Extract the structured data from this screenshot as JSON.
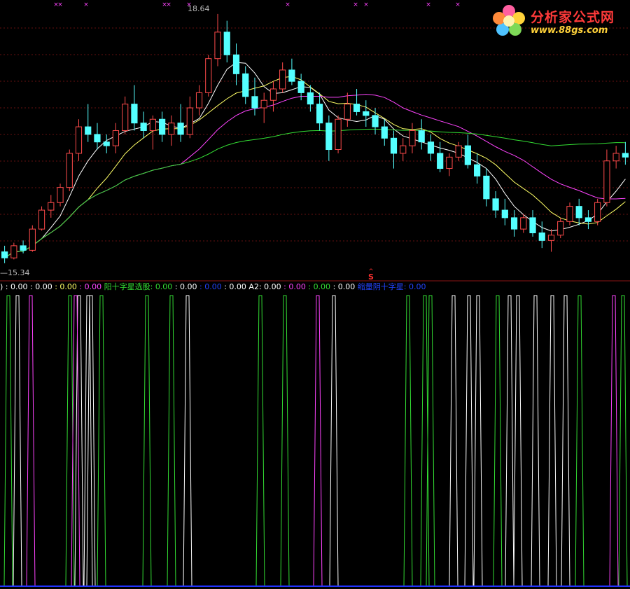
{
  "colors": {
    "background": "#000000",
    "up": "#ff4b4b",
    "down": "#54ffff",
    "ma5": "#ffffff",
    "ma10": "#ffff66",
    "ma20": "#ff44ff",
    "ma60": "#33dd33",
    "grid": "#661010",
    "signal_a": "#33dd33",
    "signal_b": "#ffffff",
    "signal_c": "#ff44ff",
    "bottom_line": "#2233ff"
  },
  "logo": {
    "title": "分析家公式网",
    "url": "www.88gs.com"
  },
  "chart_data": [
    {
      "type": "candlestick",
      "title": "",
      "price_high_label": "18.64",
      "price_low_label": "15.34",
      "high_marker": "18.64",
      "low_marker": "15.34",
      "signal_marker": "S",
      "ylim": [
        15.2,
        18.75
      ],
      "grid": true,
      "moving_averages": [
        "MA5",
        "MA10",
        "MA20",
        "MA60"
      ],
      "ohlc": [
        [
          15.5,
          15.58,
          15.35,
          15.42
        ],
        [
          15.42,
          15.62,
          15.4,
          15.58
        ],
        [
          15.58,
          15.65,
          15.48,
          15.52
        ],
        [
          15.52,
          15.85,
          15.5,
          15.8
        ],
        [
          15.8,
          16.1,
          15.78,
          16.05
        ],
        [
          16.05,
          16.25,
          15.95,
          16.15
        ],
        [
          16.15,
          16.4,
          16.1,
          16.35
        ],
        [
          16.35,
          16.85,
          16.3,
          16.8
        ],
        [
          16.8,
          17.25,
          16.7,
          17.15
        ],
        [
          17.15,
          17.45,
          16.95,
          17.05
        ],
        [
          17.05,
          17.2,
          16.85,
          16.95
        ],
        [
          16.95,
          17.05,
          16.8,
          16.9
        ],
        [
          16.9,
          17.2,
          16.8,
          17.1
        ],
        [
          17.1,
          17.55,
          17.05,
          17.45
        ],
        [
          17.45,
          17.7,
          17.1,
          17.2
        ],
        [
          17.2,
          17.35,
          17.0,
          17.1
        ],
        [
          17.1,
          17.3,
          16.85,
          17.25
        ],
        [
          17.25,
          17.35,
          16.95,
          17.05
        ],
        [
          17.05,
          17.3,
          16.9,
          17.2
        ],
        [
          17.2,
          17.45,
          16.95,
          17.05
        ],
        [
          17.05,
          17.55,
          17.0,
          17.4
        ],
        [
          17.4,
          17.7,
          17.3,
          17.6
        ],
        [
          17.6,
          18.1,
          17.55,
          18.05
        ],
        [
          18.05,
          18.64,
          17.95,
          18.4
        ],
        [
          18.4,
          18.55,
          18.0,
          18.1
        ],
        [
          18.1,
          18.25,
          17.7,
          17.85
        ],
        [
          17.85,
          17.95,
          17.45,
          17.55
        ],
        [
          17.55,
          17.8,
          17.3,
          17.4
        ],
        [
          17.4,
          17.6,
          17.2,
          17.5
        ],
        [
          17.5,
          17.75,
          17.35,
          17.65
        ],
        [
          17.65,
          18.0,
          17.6,
          17.9
        ],
        [
          17.9,
          18.05,
          17.7,
          17.75
        ],
        [
          17.75,
          17.85,
          17.5,
          17.6
        ],
        [
          17.6,
          17.7,
          17.35,
          17.45
        ],
        [
          17.45,
          17.6,
          17.1,
          17.2
        ],
        [
          17.2,
          17.3,
          16.7,
          16.85
        ],
        [
          16.85,
          17.3,
          16.8,
          17.25
        ],
        [
          17.25,
          17.6,
          17.15,
          17.45
        ],
        [
          17.45,
          17.65,
          17.3,
          17.35
        ],
        [
          17.35,
          17.5,
          17.15,
          17.3
        ],
        [
          17.3,
          17.4,
          17.05,
          17.15
        ],
        [
          17.15,
          17.25,
          16.9,
          17.0
        ],
        [
          17.0,
          17.1,
          16.6,
          16.8
        ],
        [
          16.8,
          17.0,
          16.7,
          16.9
        ],
        [
          16.9,
          17.2,
          16.8,
          17.1
        ],
        [
          17.1,
          17.25,
          16.85,
          16.95
        ],
        [
          16.95,
          17.05,
          16.7,
          16.8
        ],
        [
          16.8,
          16.95,
          16.55,
          16.6
        ],
        [
          16.6,
          16.8,
          16.5,
          16.75
        ],
        [
          16.75,
          16.95,
          16.7,
          16.9
        ],
        [
          16.9,
          17.05,
          16.6,
          16.65
        ],
        [
          16.65,
          16.8,
          16.4,
          16.5
        ],
        [
          16.5,
          16.6,
          16.1,
          16.2
        ],
        [
          16.2,
          16.3,
          15.95,
          16.05
        ],
        [
          16.05,
          16.2,
          15.85,
          15.95
        ],
        [
          15.95,
          16.05,
          15.7,
          15.8
        ],
        [
          15.8,
          16.0,
          15.75,
          15.95
        ],
        [
          15.95,
          16.05,
          15.7,
          15.75
        ],
        [
          15.75,
          15.9,
          15.55,
          15.65
        ],
        [
          15.65,
          15.8,
          15.5,
          15.72
        ],
        [
          15.72,
          15.95,
          15.68,
          15.9
        ],
        [
          15.9,
          16.15,
          15.85,
          16.1
        ],
        [
          16.1,
          16.2,
          15.85,
          15.95
        ],
        [
          15.95,
          16.05,
          15.8,
          15.9
        ],
        [
          15.9,
          16.2,
          15.85,
          16.15
        ],
        [
          16.15,
          16.85,
          16.1,
          16.7
        ],
        [
          16.7,
          16.9,
          16.6,
          16.8
        ],
        [
          16.8,
          16.95,
          16.65,
          16.75
        ]
      ]
    },
    {
      "type": "line",
      "title": "",
      "legend": [
        {
          "name": "",
          "value": "0.00",
          "color": "#ffffff"
        },
        {
          "name": "",
          "value": "0.00",
          "color": "#ffffff"
        },
        {
          "name": "",
          "value": "0.00",
          "color": "#ffff66"
        },
        {
          "name": "",
          "value": "0.00",
          "color": "#ff44ff"
        },
        {
          "name": "阳十字星选股",
          "value": "0.00",
          "color": "#33dd33"
        },
        {
          "name": "",
          "value": "0.00",
          "color": "#ffffff"
        },
        {
          "name": "",
          "value": "0.00",
          "color": "#2244ff"
        },
        {
          "name": "",
          "value": "0.00",
          "color": "#ffffff"
        },
        {
          "name": "A2",
          "value": "0.00",
          "color": "#ffffff"
        },
        {
          "name": "",
          "value": "0.00",
          "color": "#ff44ff"
        },
        {
          "name": "",
          "value": "0.00",
          "color": "#33dd33"
        },
        {
          "name": "",
          "value": "0.00",
          "color": "#ffffff"
        },
        {
          "name": "缩量阴十字星",
          "value": "0.00",
          "color": "#2244ff"
        }
      ],
      "ylim": [
        0,
        1
      ],
      "signals": [
        {
          "name": "green",
          "color": "#33dd33",
          "x": [
            12,
            100,
            145,
            210,
            245,
            372,
            407,
            583,
            607,
            615,
            711,
            828,
            890
          ]
        },
        {
          "name": "white",
          "color": "#ffffff",
          "x": [
            25,
            113,
            126,
            130,
            268,
            477,
            648,
            670,
            683,
            728,
            740,
            765,
            789,
            808
          ]
        },
        {
          "name": "magenta",
          "color": "#ff44ff",
          "x": [
            44,
            108,
            454,
            877
          ]
        }
      ]
    }
  ]
}
